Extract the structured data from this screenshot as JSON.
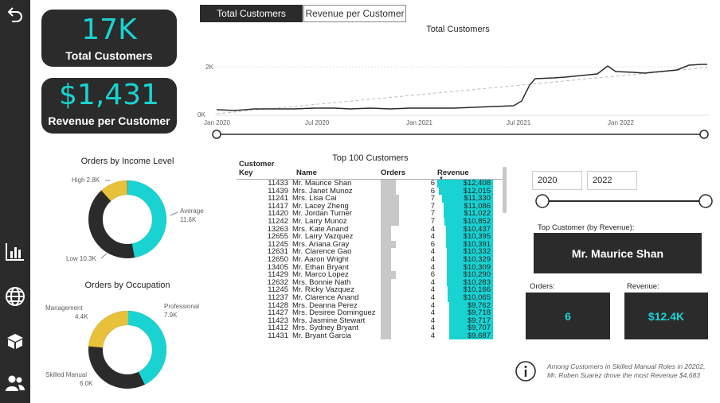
{
  "kpis": {
    "total_customers": {
      "value": "17K",
      "label": "Total Customers"
    },
    "revenue_per_customer": {
      "value": "$1,431",
      "label": "Revenue per Customer"
    }
  },
  "toggles": {
    "active": "Total Customers",
    "inactive": "Revenue per Customer"
  },
  "line_chart": {
    "title": "Total Customers",
    "y_ticks": [
      "2K",
      "0K"
    ],
    "x_ticks": [
      "Jan 2020",
      "Jul 2020",
      "Jan 2021",
      "Jul 2021",
      "Jan 2022"
    ]
  },
  "donut_income": {
    "title": "Orders by Income Level",
    "labels": [
      {
        "name": "High",
        "value": "2.8K"
      },
      {
        "name": "Average",
        "value": "11.6K"
      },
      {
        "name": "Low",
        "value": "10.3K"
      }
    ]
  },
  "donut_occupation": {
    "title": "Orders by Occupation",
    "labels": [
      {
        "name": "Management",
        "value": "4.4K"
      },
      {
        "name": "Professional",
        "value": "7.9K"
      },
      {
        "name": "Skilled Manual",
        "value": "6.0K"
      }
    ]
  },
  "table": {
    "title": "Top 100 Customers",
    "columns": [
      "Customer Key",
      "Name",
      "Orders",
      "Revenue"
    ],
    "rows": [
      [
        "11433",
        "Mr. Maurice Shan",
        "6",
        "$12,408"
      ],
      [
        "11439",
        "Mrs. Janet Munoz",
        "6",
        "$12,015"
      ],
      [
        "11241",
        "Mrs. Lisa Cai",
        "7",
        "$11,330"
      ],
      [
        "11417",
        "Mr. Lacey Zheng",
        "7",
        "$11,086"
      ],
      [
        "11420",
        "Mr. Jordan Turner",
        "7",
        "$11,022"
      ],
      [
        "11242",
        "Mr. Larry Munoz",
        "7",
        "$10,852"
      ],
      [
        "13263",
        "Mrs. Kate Anand",
        "4",
        "$10,437"
      ],
      [
        "12655",
        "Mr. Larry Vazquez",
        "4",
        "$10,395"
      ],
      [
        "11245",
        "Mrs. Ariana Gray",
        "6",
        "$10,391"
      ],
      [
        "12631",
        "Mr. Clarence Gao",
        "4",
        "$10,332"
      ],
      [
        "12650",
        "Mr. Aaron Wright",
        "4",
        "$10,329"
      ],
      [
        "13405",
        "Mr. Ethan Bryant",
        "4",
        "$10,309"
      ],
      [
        "11429",
        "Mr. Marco Lopez",
        "6",
        "$10,290"
      ],
      [
        "12632",
        "Mrs. Bonnie Nath",
        "4",
        "$10,283"
      ],
      [
        "11245",
        "Mr. Ricky Vazquez",
        "4",
        "$10,166"
      ],
      [
        "11237",
        "Mr. Clarence Anand",
        "4",
        "$10,065"
      ],
      [
        "11428",
        "Mrs. Deanna Perez",
        "4",
        "$9,762"
      ],
      [
        "11427",
        "Mrs. Desiree Dominguez",
        "4",
        "$9,718"
      ],
      [
        "11423",
        "Mrs. Jasmine Stewart",
        "4",
        "$9,717"
      ],
      [
        "11412",
        "Mrs. Sydney Bryant",
        "4",
        "$9,707"
      ],
      [
        "11431",
        "Mr. Bryant Garcia",
        "4",
        "$9,687"
      ]
    ],
    "order_fill": [
      0.27,
      0.27,
      0.32,
      0.32,
      0.32,
      0.32,
      0.18,
      0.18,
      0.27,
      0.18,
      0.18,
      0.18,
      0.27,
      0.18,
      0.18,
      0.18,
      0.18,
      0.18,
      0.18,
      0.18,
      0.18
    ],
    "revenue_fill": [
      1.0,
      0.97,
      0.91,
      0.89,
      0.89,
      0.87,
      0.84,
      0.84,
      0.84,
      0.83,
      0.83,
      0.83,
      0.83,
      0.83,
      0.82,
      0.81,
      0.79,
      0.78,
      0.78,
      0.78,
      0.78
    ]
  },
  "filters": {
    "year_from": "2020",
    "year_to": "2022"
  },
  "top_customer": {
    "label": "Top Customer (by Revenue):",
    "name": "Mr. Maurice Shan",
    "orders_label": "Orders:",
    "orders": "6",
    "revenue_label": "Revenue:",
    "revenue": "$12.4K"
  },
  "insight": "Among Customers in Skilled Manual Roles in 20202, Mr. Ruben Suarez drove the most Revenue $4,683",
  "colors": {
    "accent": "#19d3d3",
    "dark": "#2b2b2b",
    "yellow": "#e8c13a"
  }
}
